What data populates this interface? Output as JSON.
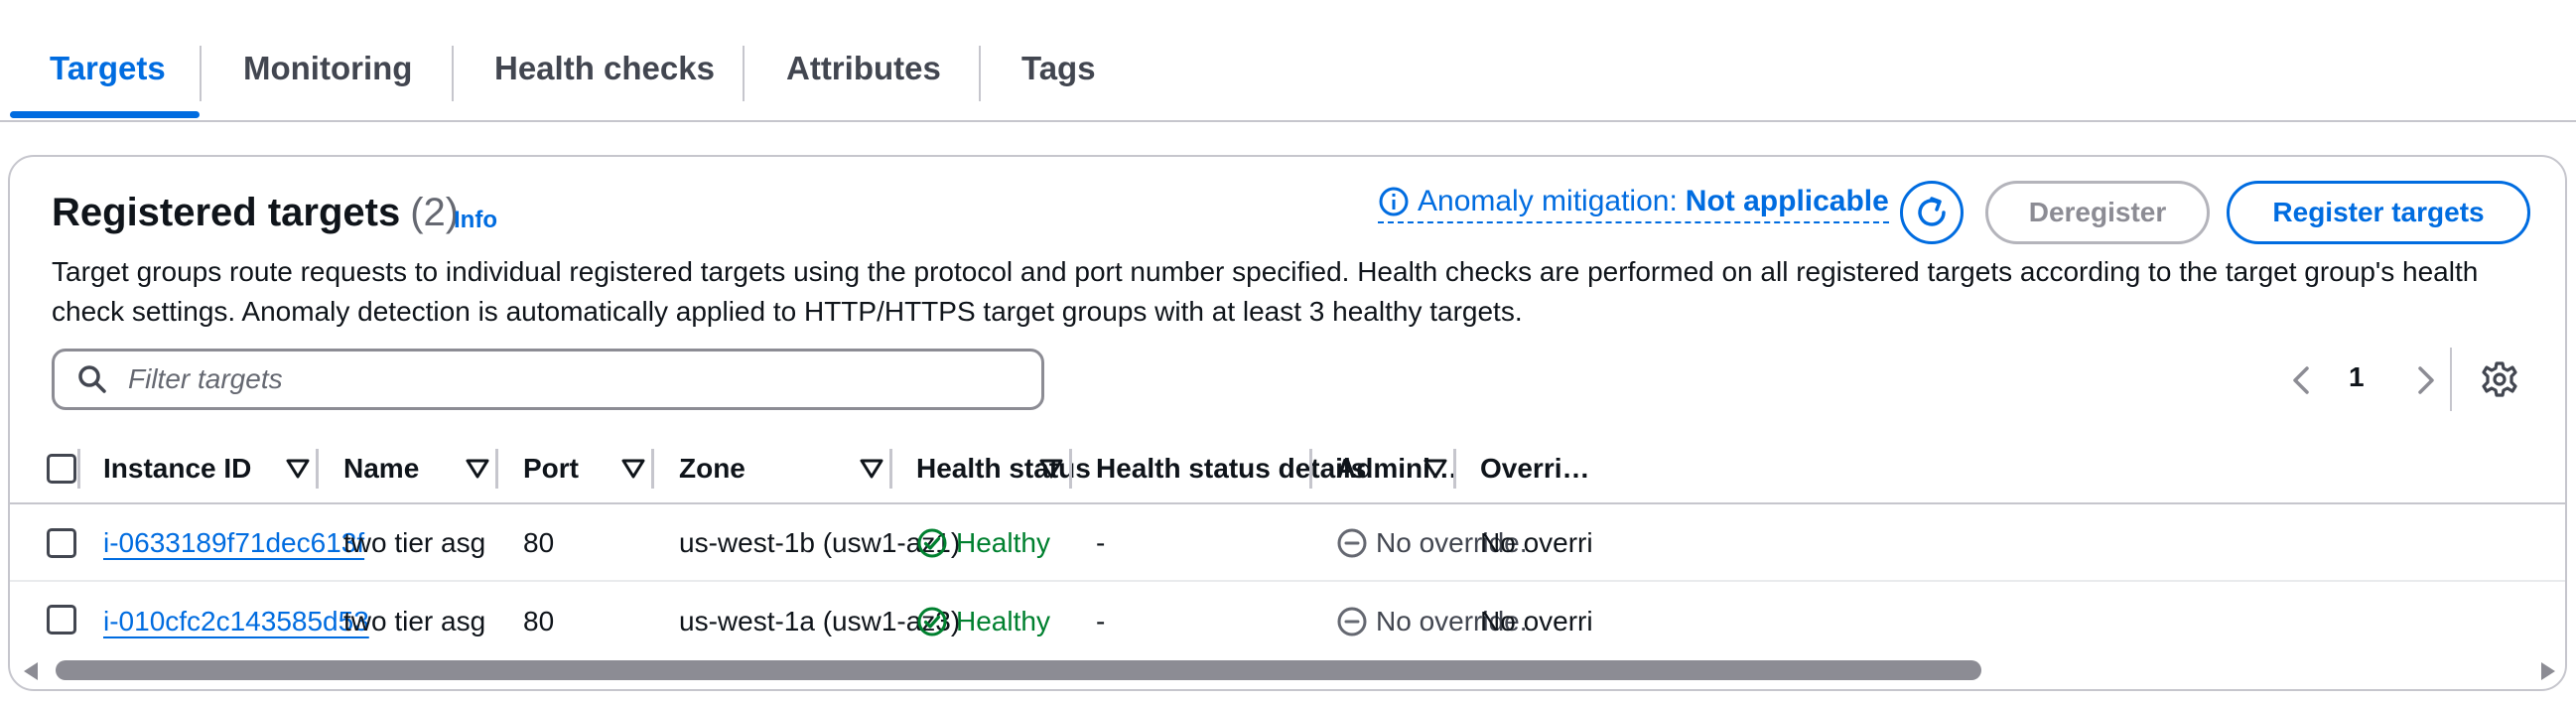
{
  "tabs": [
    {
      "label": "Targets",
      "active": true
    },
    {
      "label": "Monitoring",
      "active": false
    },
    {
      "label": "Health checks",
      "active": false
    },
    {
      "label": "Attributes",
      "active": false
    },
    {
      "label": "Tags",
      "active": false
    }
  ],
  "panel": {
    "title": "Registered targets",
    "count": "(2)",
    "info": "Info",
    "anomaly_label": "Anomaly mitigation:",
    "anomaly_value": "Not applicable",
    "deregister": "Deregister",
    "register": "Register targets",
    "description": "Target groups route requests to individual registered targets using the protocol and port number specified. Health checks are performed on all registered targets according to the target group's health check settings. Anomaly detection is automatically applied to HTTP/HTTPS target groups with at least 3 healthy targets."
  },
  "search": {
    "placeholder": "Filter targets",
    "value": ""
  },
  "pagination": {
    "current_page": "1"
  },
  "table": {
    "columns": [
      "Instance ID",
      "Name",
      "Port",
      "Zone",
      "Health status",
      "Health status details",
      "Admini…",
      "Overri…"
    ],
    "rows": [
      {
        "instance_id": "i-0633189f71dec613f",
        "name": "two tier asg",
        "port": "80",
        "zone": "us-west-1b (usw1-az1)",
        "health": "Healthy",
        "details": "-",
        "admin_override": "No override.",
        "override": "No overri"
      },
      {
        "instance_id": "i-010cfc2c143585d53",
        "name": "two tier asg",
        "port": "80",
        "zone": "us-west-1a (usw1-az3)",
        "health": "Healthy",
        "details": "-",
        "admin_override": "No override.",
        "override": "No overri"
      }
    ]
  },
  "colors": {
    "accent": "#006ce0",
    "healthy": "#00802f",
    "border": "#c6c6cd",
    "text": "#0f141a",
    "muted": "#656871"
  },
  "icons": [
    "info-icon",
    "refresh-icon",
    "search-icon",
    "chevron-left-icon",
    "chevron-right-icon",
    "settings-gear-icon",
    "sort-caret-icon",
    "healthy-check-icon",
    "no-override-icon"
  ]
}
